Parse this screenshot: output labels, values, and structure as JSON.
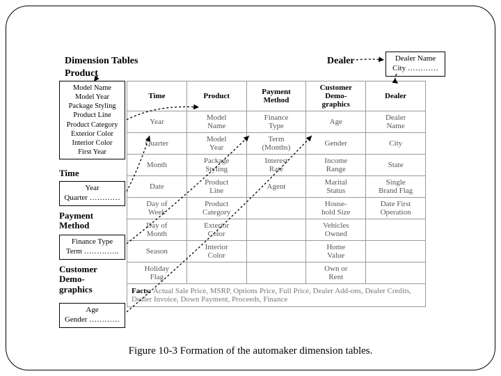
{
  "headings": {
    "dimTables": "Dimension  Tables",
    "product": "Product",
    "dealer": "Dealer"
  },
  "externalBoxes": {
    "dealer": "Dealer Name\nCity …………",
    "product": "Model Name\nModel Year\nPackage Styling\nProduct Line\nProduct Category\nExterior Color\nInterior Color\nFirst Year",
    "time": "Year\nQuarter …………",
    "paymentMethod": "Finance Type\nTerm …………..",
    "customerDemo": "Age\nGender …………"
  },
  "sideLabels": {
    "time": "Time",
    "paymentMethod": "Payment\nMethod",
    "customerDemographics": "Customer\nDemo-\ngraphics"
  },
  "table": {
    "headers": [
      "Time",
      "Product",
      "Payment\nMethod",
      "Customer\nDemo-\ngraphics",
      "Dealer"
    ],
    "rows": [
      [
        "Year",
        "Model\nName",
        "Finance\nType",
        "Age",
        "Dealer\nName"
      ],
      [
        "Quarter",
        "Model\nYear",
        "Term\n(Months)",
        "Gender",
        "City"
      ],
      [
        "Month",
        "Package\nStyling",
        "Interest\nRate",
        "Income\nRange",
        "State"
      ],
      [
        "Date",
        "Product\nLine",
        "Agent",
        "Marital\nStatus",
        "Single\nBrand Flag"
      ],
      [
        "Day of\nWeek",
        "Product\nCategory",
        "",
        "House-\nhold Size",
        "Date First\nOperation"
      ],
      [
        "Day of\nMonth",
        "Exterior\nColor",
        "",
        "Vehicles\nOwned",
        ""
      ],
      [
        "Season",
        "Interior\nColor",
        "",
        "Home\nValue",
        ""
      ],
      [
        "Holiday\nFlag",
        "",
        "",
        "Own or\nRent",
        ""
      ]
    ],
    "factsLabel": "Facts:",
    "factsText": " Actual Sale Price, MSRP, Options Price, Full Price, Dealer Add-ons, Dealer Credits, Dealer Invoice, Down Payment, Proceeds, Finance"
  },
  "caption": "Figure 10-3 Formation of the automaker dimension tables."
}
